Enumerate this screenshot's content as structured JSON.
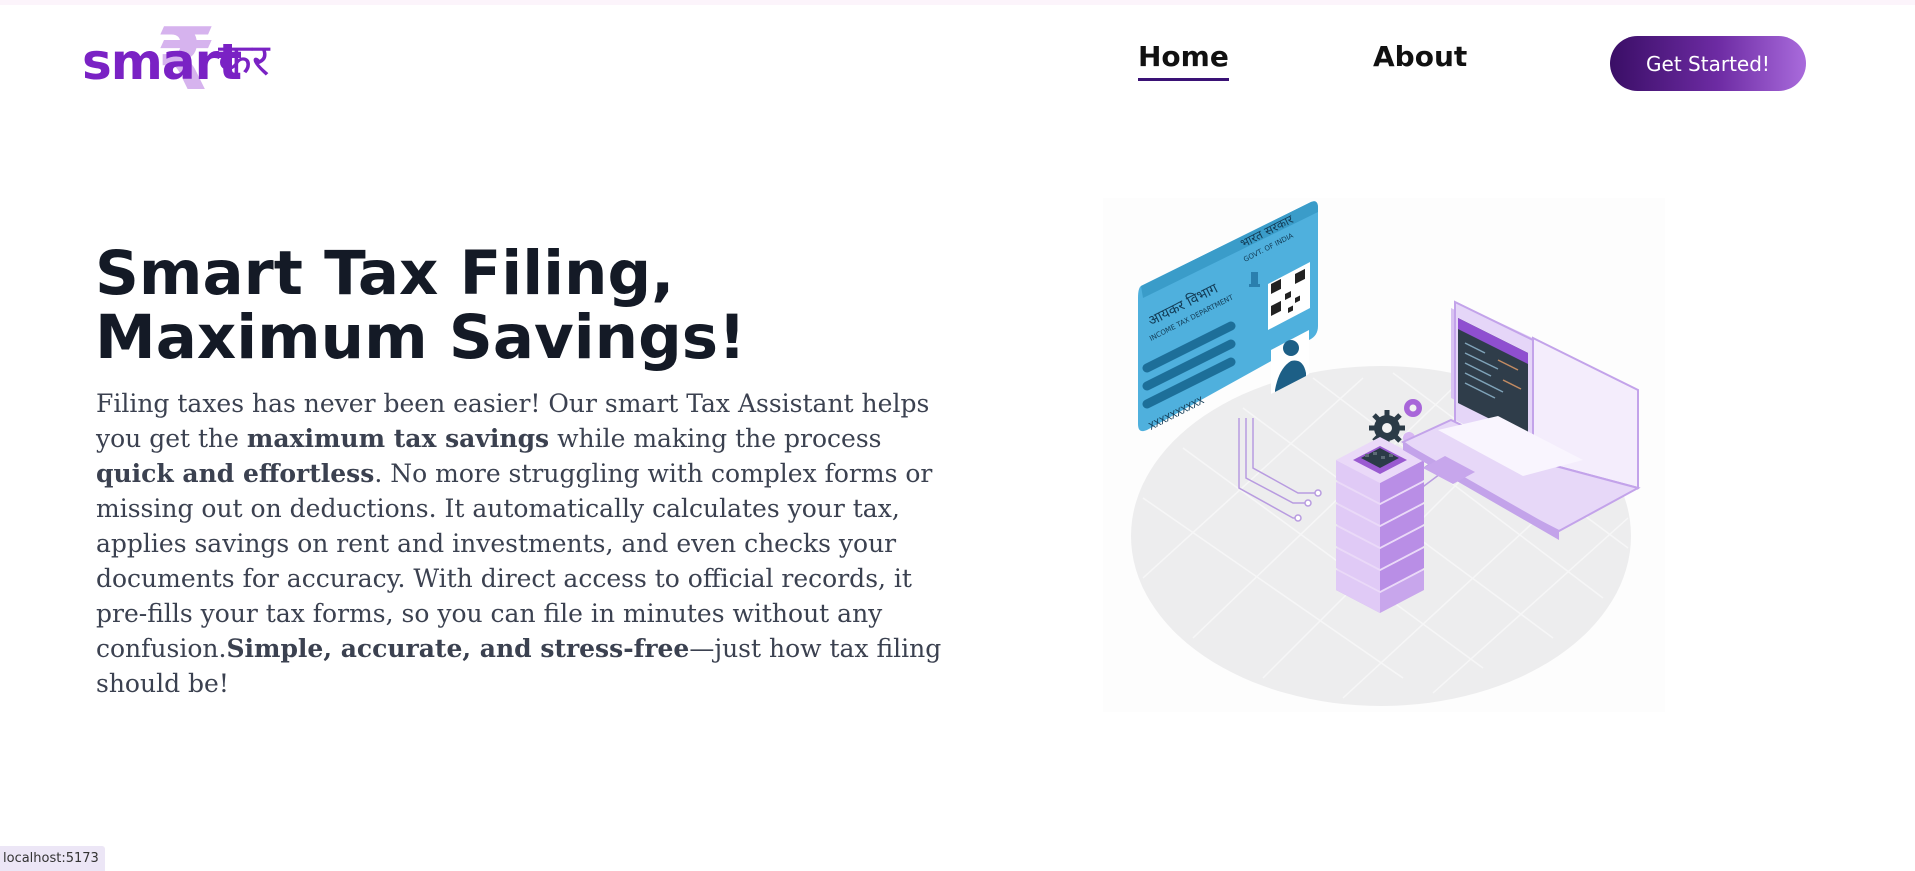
{
  "logo": {
    "word": "smart",
    "hindi": "कर",
    "symbol": "₹"
  },
  "nav": {
    "home_label": "Home",
    "about_label": "About",
    "cta_label": "Get Started!"
  },
  "hero": {
    "title": "Smart Tax Filing, Maximum Savings!",
    "description": {
      "p1": "Filing taxes has never been easier! Our smart Tax Assistant helps you get the ",
      "b1": "maximum tax savings",
      "p2": " while making the process ",
      "b2": "quick and effortless",
      "p3": ". No more struggling with complex forms or missing out on deductions. It automatically calculates your tax, applies savings on rent and investments, and even checks your documents for accuracy. With direct access to official records, it pre-fills your tax forms, so you can file in minutes without any confusion.",
      "b3": "Simple, accurate, and stress-free",
      "p4": "—just how tax filing should be!"
    }
  },
  "illustration": {
    "card_dept_hindi": "आयकर विभाग",
    "card_dept_en": "INCOME TAX DEPARTMENT",
    "card_govt_hindi": "भारत सरकार",
    "card_govt_en": "GOVT. OF INDIA",
    "card_number": "XXXXXXXXXX"
  },
  "status": {
    "url": "localhost:5173"
  },
  "colors": {
    "brand_purple": "#7a22c4",
    "cta_dark": "#3a0e66",
    "cta_light": "#a96bdc",
    "card_blue": "#4fb0dd",
    "accent_lilac": "#c9a8ec"
  }
}
